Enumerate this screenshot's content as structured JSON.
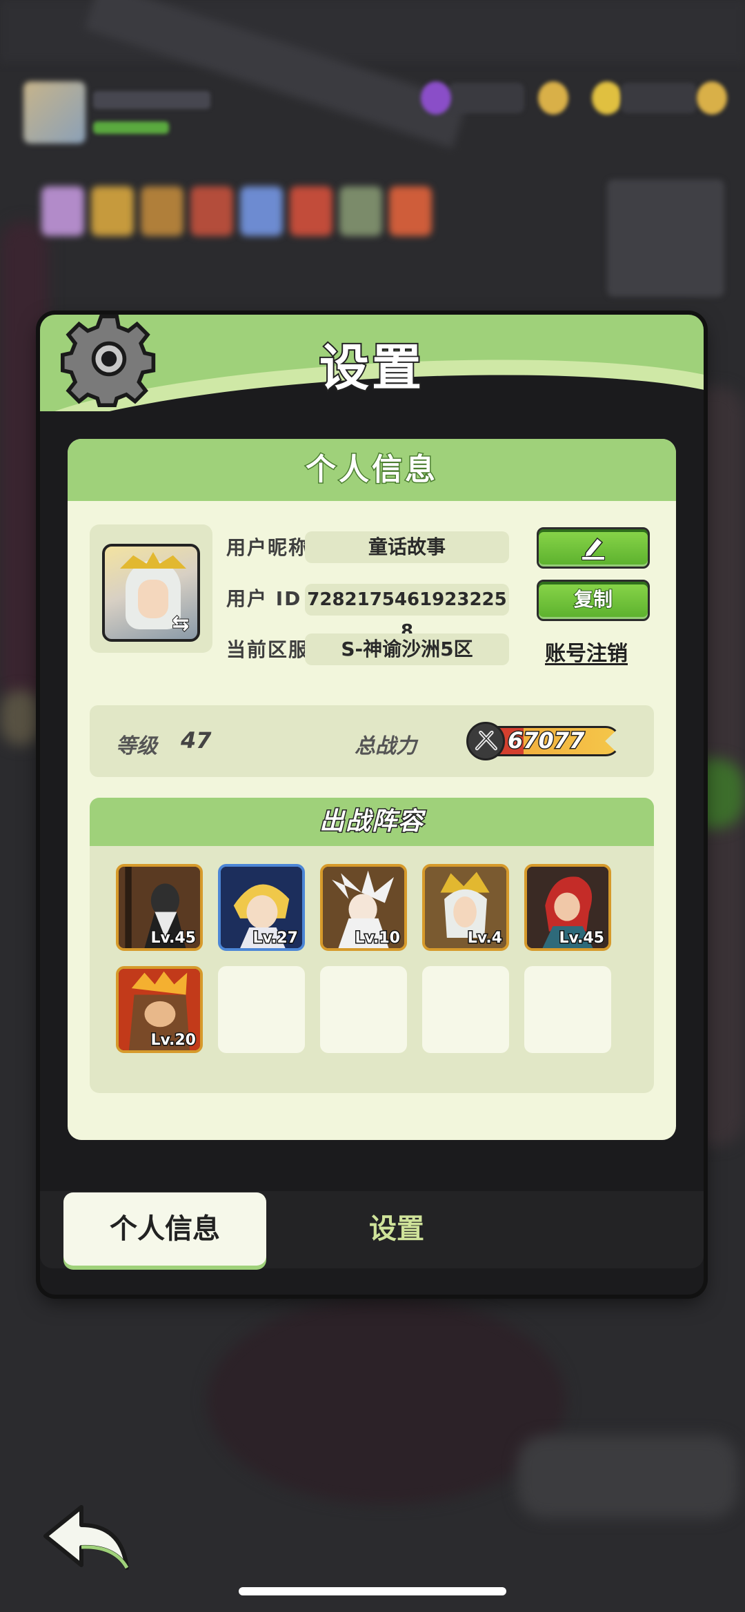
{
  "modal": {
    "title": "设置",
    "section_title": "个人信息"
  },
  "profile": {
    "nickname_label": "用户昵称",
    "nickname": "童话故事",
    "id_label": "用户 ID",
    "user_id": "7282175461923225​8",
    "server_label": "当前区服",
    "server": "S-神谕沙洲5区",
    "copy_label": "复制",
    "delete_account_label": "账号注销"
  },
  "stats": {
    "level_label": "等级",
    "level": "47",
    "power_label": "总战力",
    "power": "67077"
  },
  "lineup": {
    "title": "出战阵容",
    "heroes": [
      {
        "level": "Lv.45",
        "frame": "gold"
      },
      {
        "level": "Lv.27",
        "frame": "blue"
      },
      {
        "level": "Lv.10",
        "frame": "gold"
      },
      {
        "level": "Lv.4",
        "frame": "gold"
      },
      {
        "level": "Lv.45",
        "frame": "gold"
      },
      {
        "level": "Lv.20",
        "frame": "gold"
      }
    ],
    "empty_slots": 4
  },
  "tabs": {
    "active": "个人信息",
    "inactive": "设置"
  },
  "colors": {
    "accent_green": "#9fd17a",
    "card_bg": "#f2f6dc",
    "button_green": "#5bb02d",
    "hero_frame_gold": "#d69a2b",
    "hero_frame_blue": "#4c86d6"
  },
  "icons": [
    "gear-icon",
    "edit-icon",
    "swap-icon",
    "power-icon",
    "back-arrow-icon"
  ]
}
